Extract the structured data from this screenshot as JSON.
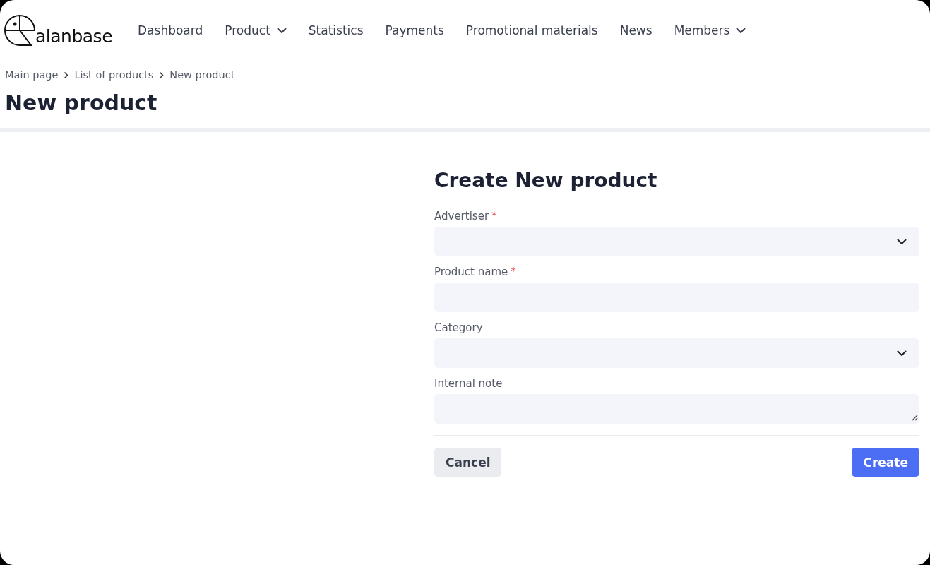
{
  "header": {
    "logo": {
      "text": "alanbase"
    },
    "nav": [
      {
        "label": "Dashboard",
        "has_menu": false
      },
      {
        "label": "Product",
        "has_menu": true
      },
      {
        "label": "Statistics",
        "has_menu": false
      },
      {
        "label": "Payments",
        "has_menu": false
      },
      {
        "label": "Promotional materials",
        "has_menu": false
      },
      {
        "label": "News",
        "has_menu": false
      },
      {
        "label": "Members",
        "has_menu": true
      }
    ]
  },
  "breadcrumbs": [
    "Main page",
    "List of products",
    "New product"
  ],
  "page_title": "New product",
  "form": {
    "title": "Create New product",
    "fields": [
      {
        "kind": "select",
        "label": "Advertiser",
        "required_mark": "*"
      },
      {
        "kind": "text",
        "label": "Product name",
        "required_mark": "*"
      },
      {
        "kind": "select",
        "label": "Category"
      },
      {
        "kind": "textarea",
        "label": "Internal note"
      }
    ],
    "buttons": [
      {
        "kind": "secondary",
        "label": "Cancel"
      },
      {
        "kind": "primary",
        "label": "Create"
      }
    ]
  }
}
